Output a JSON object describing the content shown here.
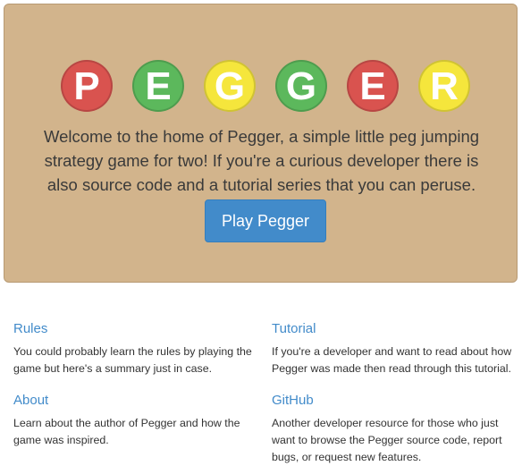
{
  "hero": {
    "logo_letters": [
      {
        "letter": "P",
        "color": "#d9534f"
      },
      {
        "letter": "E",
        "color": "#5cb85c"
      },
      {
        "letter": "G",
        "color": "#f5e63c"
      },
      {
        "letter": "G",
        "color": "#5cb85c"
      },
      {
        "letter": "E",
        "color": "#d9534f"
      },
      {
        "letter": "R",
        "color": "#f5e63c"
      }
    ],
    "welcome_text": "Welcome to the home of Pegger, a simple little peg jumping strategy game for two! If you're a curious developer there is also source code and a tutorial series that you can peruse.",
    "play_button": "Play Pegger",
    "background_color": "#d2b48c"
  },
  "sections": {
    "rules": {
      "title": "Rules",
      "text": "You could probably learn the rules by playing the game but here's a summary just in case."
    },
    "tutorial": {
      "title": "Tutorial",
      "text": "If you're a developer and want to read about how Pegger was made then read through this tutorial."
    },
    "about": {
      "title": "About",
      "text": "Learn about the author of Pegger and how the game was inspired."
    },
    "github": {
      "title": "GitHub",
      "text": "Another developer resource for those who just want to browse the Pegger source code, report bugs, or request new features."
    }
  },
  "colors": {
    "link": "#428bca",
    "button": "#428bca"
  }
}
